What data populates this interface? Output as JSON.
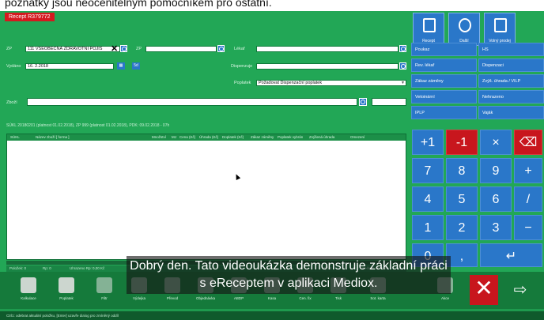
{
  "top_caption": "poznatky jsou neocenitelným pomocníkem pro ostatní.",
  "recept_tag": "Recept  R379772",
  "form": {
    "zp_label": "ZP",
    "zp_value": "111  VŠEOBECNÁ ZDRAVOTNÍ POJIŠ",
    "zp2_label": "ZP",
    "vydano_label": "Vydáno",
    "vydano_value": "16. 2.2018",
    "date_button": "5d",
    "lekar_label": "Lékař",
    "dispenzuje_label": "Dispenzuje",
    "poplatek_label": "Poplatek",
    "poplatek_value": "Požadovat Dispenzační poplatek",
    "zbozi_label": "Zboží"
  },
  "info_line": "SÚKL 20180201 (platnost 01.02.2018), ZP 999 (platnost 01.02.2018), PDK: 09.02.2018 - 07h",
  "table": {
    "headers": [
      "SÚKL",
      "Název zboží [ forma ]",
      "Množství",
      "MJ",
      "Cena (Kč)",
      "Úhrada (Kč)",
      "Doplatek (Kč)",
      "Zákaz záměny",
      "Poplatek vybrán",
      "Zvýšená úhrada",
      "Omezení"
    ]
  },
  "status": {
    "polozek": "Položek: 0",
    "rp": "Rp: 0",
    "uhrazeno": "Uhrazeno Rp: 0,00 Kč",
    "vycet": "Výčet",
    "celkem": "Celkem Kč: 0,00"
  },
  "right_panel": {
    "tiles": [
      {
        "label": "Recept",
        "icon": "document-icon"
      },
      {
        "label": "Další",
        "icon": "play-icon"
      },
      {
        "label": "Volný prodej",
        "icon": "cash-icon"
      }
    ],
    "buttons": [
      "Poukaz",
      "HS",
      "Rev. lékař",
      "Dispenzaci",
      "Zákaz záměny",
      "Zvýš. úhrada / VILP",
      "Vetoinární",
      "Nehrazeno",
      "IPLP",
      "Vaják"
    ]
  },
  "keypad": {
    "row1": [
      "+1",
      "-1",
      "×",
      "⌫"
    ],
    "row2": [
      "7",
      "8",
      "9",
      "+"
    ],
    "row3": [
      "4",
      "5",
      "6",
      "/"
    ],
    "row4": [
      "1",
      "2",
      "3",
      "−"
    ],
    "row5": [
      "0",
      ",",
      "↵"
    ]
  },
  "taskbar": [
    "Kalkulace",
    "Poplatek",
    "Filtr",
    "Výdejka",
    "Převod",
    "Objednávka",
    "ABDP",
    "Kasa",
    "Cen. fix",
    "Tisk",
    "Sot. karta",
    "Akce",
    "Zrušit",
    "Konec"
  ],
  "footer": "Ctrl1: odebrat aktuální položku, [Enter] uzavře dialog pro zmíněný oddíl",
  "subtitle": "Dobrý den. Tato videoukázka demonstruje základní práci s eReceptem v aplikaci Mediox."
}
